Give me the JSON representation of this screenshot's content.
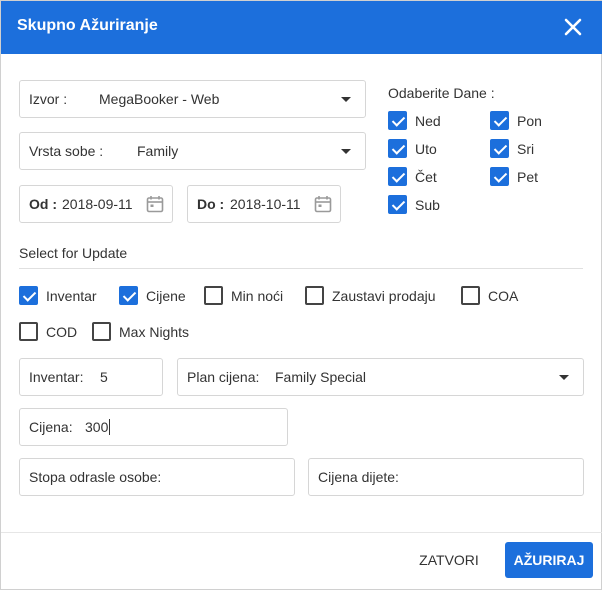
{
  "dialog": {
    "title": "Skupno Ažuriranje",
    "close_icon": "close-icon",
    "header_color": "#1c6fdc"
  },
  "source": {
    "label": "Izvor :",
    "value": "MegaBooker - Web"
  },
  "room_type": {
    "label": "Vrsta sobe :",
    "value": "Family"
  },
  "date_from": {
    "label": "Od :",
    "value": "2018-09-11"
  },
  "date_to": {
    "label": "Do :",
    "value": "2018-10-11"
  },
  "days": {
    "title": "Odaberite Dane :",
    "items": [
      {
        "label": "Ned",
        "checked": true
      },
      {
        "label": "Pon",
        "checked": true
      },
      {
        "label": "Uto",
        "checked": true
      },
      {
        "label": "Sri",
        "checked": true
      },
      {
        "label": "Čet",
        "checked": true
      },
      {
        "label": "Pet",
        "checked": true
      },
      {
        "label": "Sub",
        "checked": true
      }
    ]
  },
  "update": {
    "title": "Select for Update",
    "items": [
      {
        "label": "Inventar",
        "checked": true
      },
      {
        "label": "Cijene",
        "checked": true
      },
      {
        "label": "Min noći",
        "checked": false
      },
      {
        "label": "Zaustavi prodaju",
        "checked": false
      },
      {
        "label": "COA",
        "checked": false
      },
      {
        "label": "COD",
        "checked": false
      },
      {
        "label": "Max Nights",
        "checked": false
      }
    ]
  },
  "inventory": {
    "label": "Inventar:",
    "value": "5"
  },
  "rate_plan": {
    "label": "Plan cijena:",
    "value": "Family Special"
  },
  "price": {
    "label": "Cijena:",
    "value": "300"
  },
  "adult_rate": {
    "label": "Stopa odrasle osobe:",
    "value": ""
  },
  "child_price": {
    "label": "Cijena dijete:",
    "value": ""
  },
  "footer": {
    "close_label": "ZATVORI",
    "update_label": "AŽURIRAJ"
  }
}
